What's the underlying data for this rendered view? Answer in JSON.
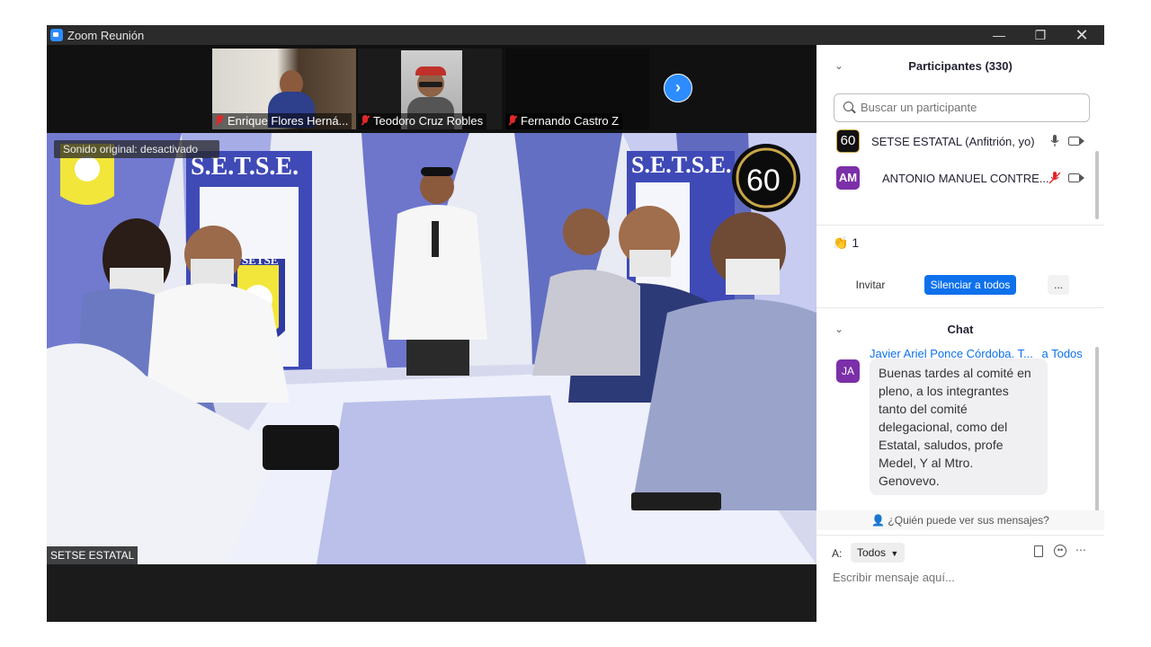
{
  "window": {
    "title": "Zoom Reunión"
  },
  "gallery": [
    {
      "name": "Enrique Flores Herná..."
    },
    {
      "name": "Teodoro Cruz Robles"
    },
    {
      "name": "Fernando Castro Z"
    }
  ],
  "video": {
    "original_sound": "Sonido original: desactivado",
    "speaker_label": "SETSE ESTATAL",
    "banner_text": "S.E.T.S.E.",
    "emblem_text": "SETSE",
    "anniversary": "60"
  },
  "participants": {
    "title": "Participantes (330)",
    "search_placeholder": "Buscar un participante",
    "items": [
      {
        "avatar_text": "60",
        "name": "SETSE ESTATAL (Anfitrión, yo)",
        "avatar_color": "#111111"
      },
      {
        "avatar_text": "AM",
        "name": "ANTONIO MANUEL CONTRE...",
        "avatar_color": "#7b2fa8"
      }
    ],
    "reaction_count": "1",
    "invite_label": "Invitar",
    "mute_all_label": "Silenciar a todos",
    "more_label": "..."
  },
  "chat": {
    "title": "Chat",
    "message": {
      "sender": "Javier Ariel Ponce Córdoba. T...",
      "to": "a Todos",
      "avatar_text": "JA",
      "avatar_color": "#7b2fa8",
      "lines": [
        "Buenas tardes al comité en",
        "pleno, a los integrantes",
        "tanto del comité",
        "delegacional, como del",
        "Estatal, saludos, profe",
        "Medel, Y al Mtro.",
        "Genovevo."
      ]
    },
    "who_can_see": "¿Quién puede ver sus mensajes?",
    "to_label": "A:",
    "recipient": "Todos",
    "input_placeholder": "Escribir mensaje aquí..."
  },
  "colors": {
    "accent": "#2d8cff",
    "mute_red": "#e02828",
    "link_blue": "#0e71eb"
  }
}
